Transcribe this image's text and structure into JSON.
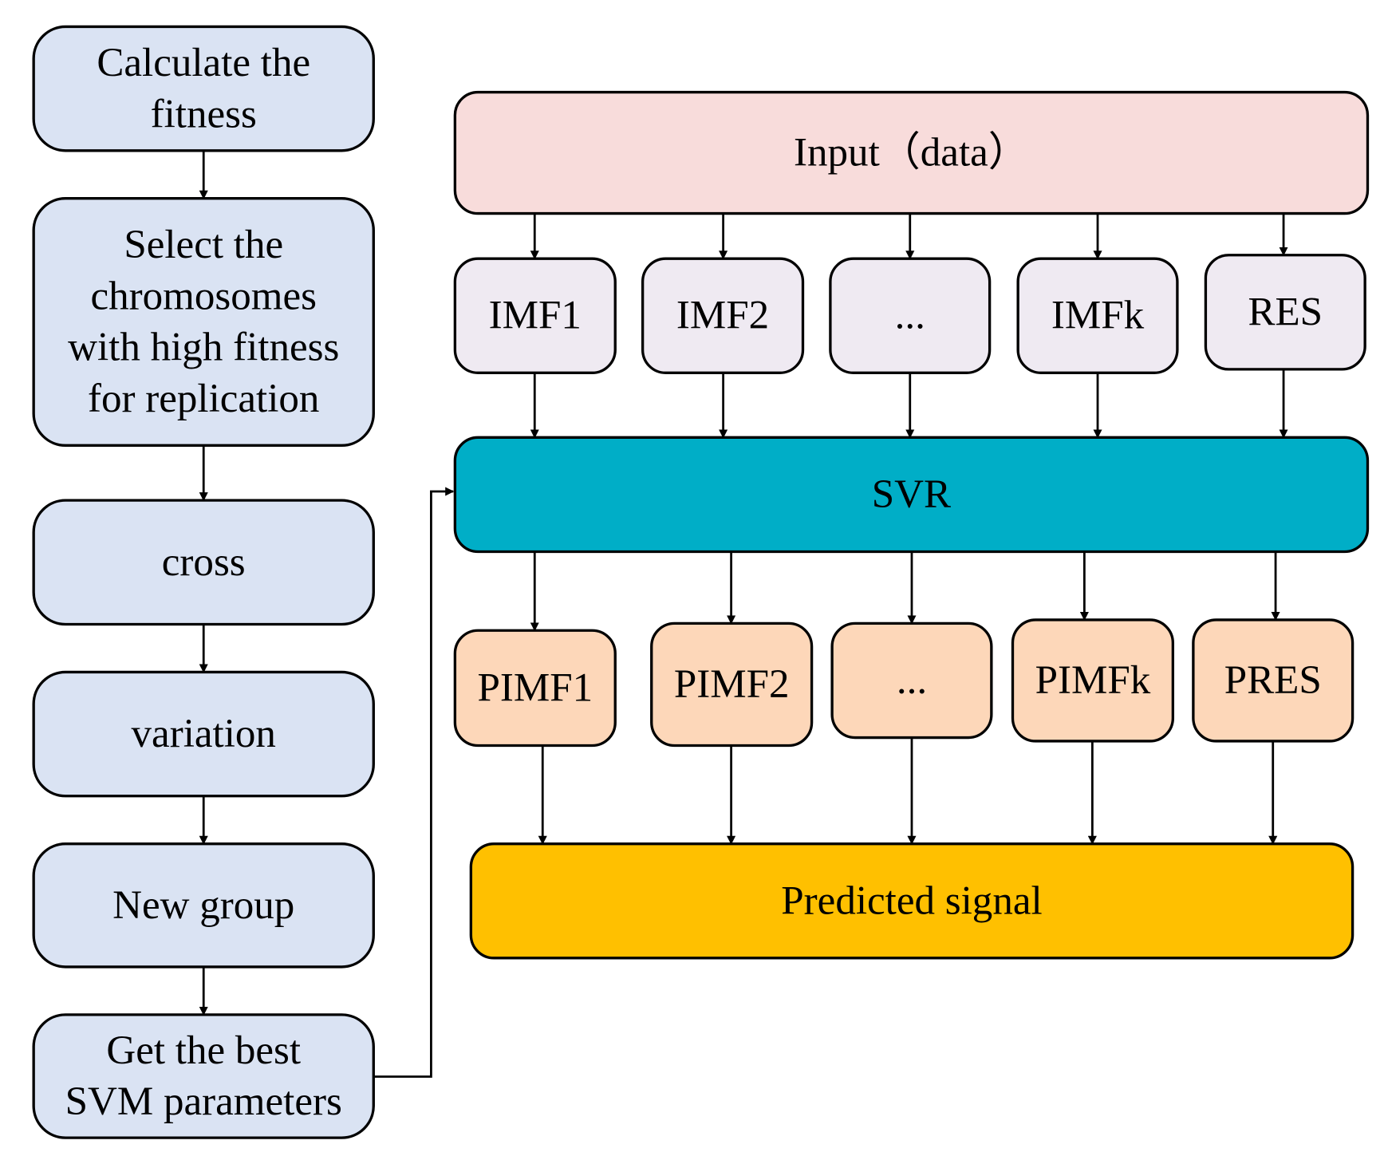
{
  "left_flow": [
    [
      "Calculate the",
      "fitness"
    ],
    [
      "Select the",
      "chromosomes",
      "with high fitness",
      "for replication"
    ],
    [
      "cross"
    ],
    [
      "variation"
    ],
    [
      "New group"
    ],
    [
      "Get the best",
      "SVM parameters"
    ]
  ],
  "input": "Input（data）",
  "imfs": [
    "IMF1",
    "IMF2",
    "...",
    "IMFk",
    "RES"
  ],
  "svr": "SVR",
  "pimfs": [
    "PIMF1",
    "PIMF2",
    "...",
    "PIMFk",
    "PRES"
  ],
  "output": "Predicted signal",
  "colors": {
    "left": "#dae3f3",
    "input": "#f8dcdb",
    "imf": "#efeaf2",
    "svr": "#00aec7",
    "pimf": "#fdd7b9",
    "output": "#ffc000"
  }
}
